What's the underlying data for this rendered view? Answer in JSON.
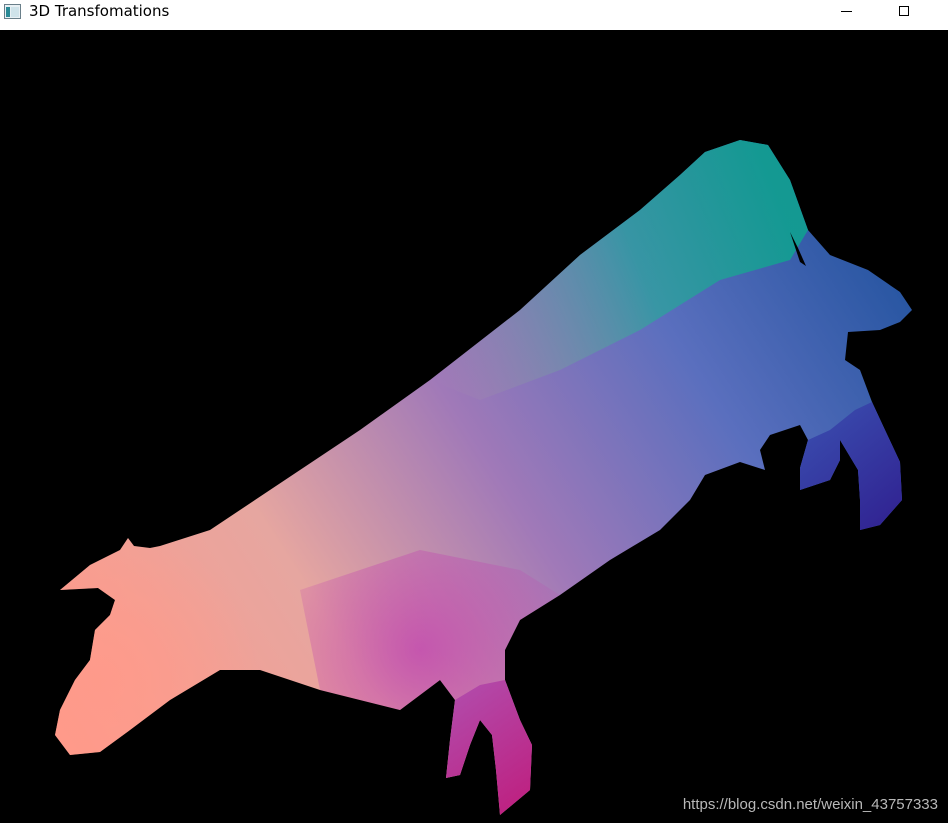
{
  "window": {
    "title": "3D Transfomations",
    "icon": "app-window-icon",
    "controls": {
      "minimize_icon": "minimize-icon",
      "maximize_icon": "maximize-icon"
    }
  },
  "viewport": {
    "background": "#000000",
    "model": "cow",
    "shading": "normal-color",
    "colors": {
      "head": "#ff9a8a",
      "back": "#1aa59a",
      "rear": "#1a4f9a",
      "belly": "#7a5fb8",
      "front_legs": "#c020a8",
      "rear_legs": "#3020a8"
    }
  },
  "watermark": {
    "text": "https://blog.csdn.net/weixin_43757333"
  }
}
